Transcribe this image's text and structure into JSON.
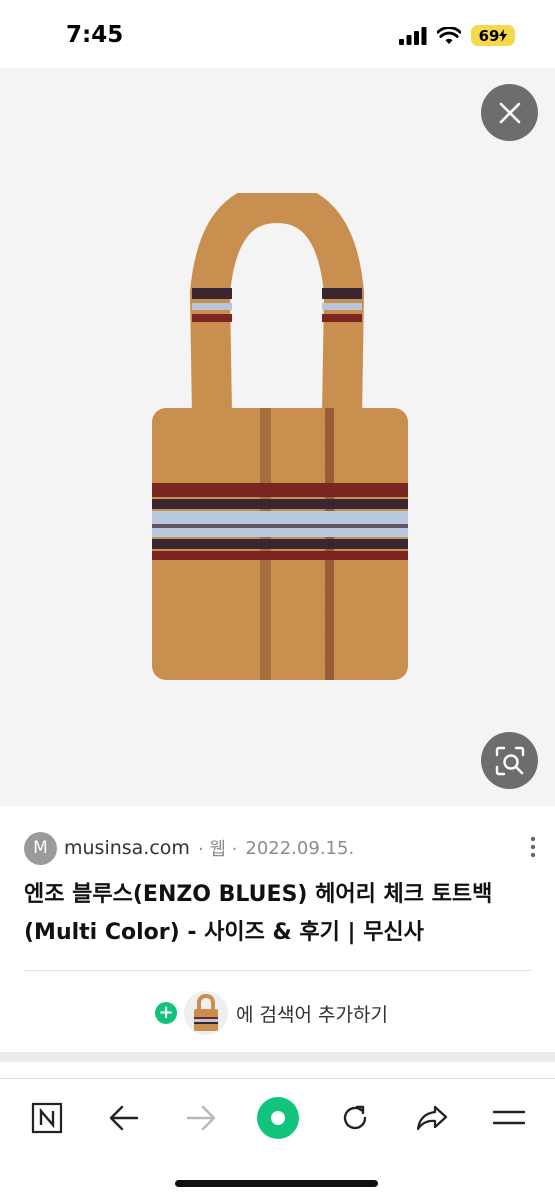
{
  "status_bar": {
    "time": "7:45",
    "battery": "69"
  },
  "image_viewer": {
    "close_icon": "close-icon",
    "lens_icon": "image-search-icon",
    "image_subject": "plaid fuzzy tote bag"
  },
  "result": {
    "favicon_letter": "M",
    "domain": "musinsa.com",
    "type": "· 웹 ·",
    "date": "2022.09.15.",
    "title": "엔조 블루스(ENZO BLUES) 헤어리 체크 토트백 (Multi Color) - 사이즈 & 후기 | 무신사"
  },
  "add_search": {
    "plus": "+",
    "label": "에 검색어 추가하기"
  },
  "toolbar": {
    "items": [
      "naver-home-icon",
      "back-arrow-icon",
      "forward-arrow-icon",
      "green-record-icon",
      "refresh-icon",
      "share-icon",
      "menu-icon"
    ]
  },
  "colors": {
    "accent_green": "#11c47c",
    "battery_yellow": "#f5d94a",
    "overlay_button": "#6d6d6d"
  }
}
